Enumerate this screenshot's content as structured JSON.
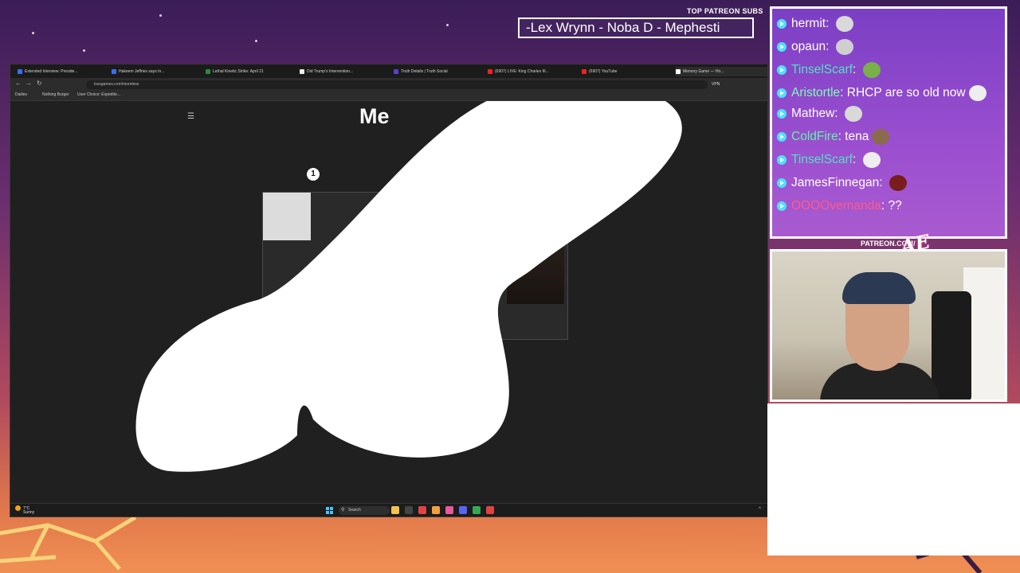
{
  "overlay": {
    "top_subs_label": "TOP PATREON SUBS",
    "top_subs_names": "-Lex Wrynn -  Noba D - Mephesti",
    "patreon_url": "PATREON.COM/",
    "logo_text": "Anything Else?"
  },
  "browser": {
    "tabs": [
      {
        "label": "Extended Interview: Preside...",
        "color": "#3a6df0"
      },
      {
        "label": "Hakeem Jeffries says In...",
        "color": "#3a6df0"
      },
      {
        "label": "Lethal Kinetic Strike: April 21",
        "color": "#2b8a3e"
      },
      {
        "label": "Did Trump's Intervention...",
        "color": "#eee"
      },
      {
        "label": "Truth Details | Truth Social",
        "color": "#5a3fd0"
      },
      {
        "label": "(6907) LIVE: King Charles III...",
        "color": "#e22"
      },
      {
        "label": "(6907) YouTube",
        "color": "#e22"
      },
      {
        "label": "Memory Game — Ho...",
        "color": "#fff"
      }
    ],
    "url": "lossgames.com/moreless",
    "vpn": "VPN",
    "bookmarks": [
      "Dailies",
      "Nothing Burger",
      "User Choice: Expedite..."
    ]
  },
  "page": {
    "title": "Me",
    "step_number": "1"
  },
  "taskbar": {
    "temp": "7°C",
    "weather": "Sunny",
    "search_label": "Search",
    "apps": [
      {
        "name": "file-explorer",
        "color": "#f2c14e"
      },
      {
        "name": "terminal",
        "color": "#444"
      },
      {
        "name": "browser-red",
        "color": "#e04545"
      },
      {
        "name": "files",
        "color": "#f2a13a"
      },
      {
        "name": "photos",
        "color": "#e85a9a"
      },
      {
        "name": "discord",
        "color": "#5865f2"
      },
      {
        "name": "chrome",
        "color": "#34a853"
      },
      {
        "name": "app-multicolor",
        "color": "#d44"
      }
    ]
  },
  "chat": [
    {
      "user": "hermit",
      "color": "#ffffff",
      "message": ""
    },
    {
      "user": "opaun",
      "color": "#ffffff",
      "message": ""
    },
    {
      "user": "TinselScarf",
      "color": "#4fe3c1",
      "message": ""
    },
    {
      "user": "Aristortle",
      "color": "#7dffb0",
      "message": "RHCP are so old now"
    },
    {
      "user": "Mathew",
      "color": "#ffffff",
      "message": ""
    },
    {
      "user": "ColdFire",
      "color": "#5ff5a0",
      "message": "tena"
    },
    {
      "user": "TinselScarf",
      "color": "#4fe3c1",
      "message": ""
    },
    {
      "user": "JamesFinnegan",
      "color": "#ffffff",
      "message": ""
    },
    {
      "user": "OOOOvernanda",
      "color": "#ff5a8a",
      "message": "??"
    }
  ],
  "colors": {
    "chat_bullet": "#4ce1ff",
    "taskbar_start": "#4cc2ff"
  }
}
